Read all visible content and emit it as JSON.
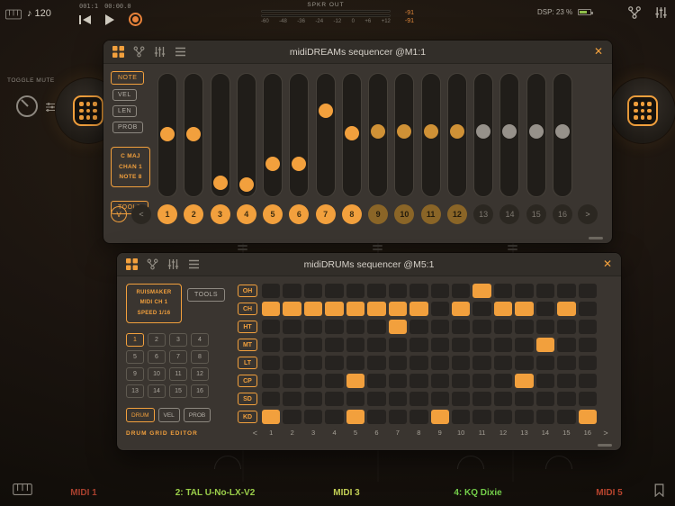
{
  "topbar": {
    "tempo_note": "♪",
    "tempo": "120",
    "time_bars": "001:1",
    "time_clock": "00:00.0",
    "spkr_label": "SPKR OUT",
    "meter_ticks": [
      "-60",
      "-48",
      "-36",
      "-24",
      "-12",
      "0",
      "+6",
      "+12"
    ],
    "db_left": "-91",
    "db_right": "-91",
    "dsp": "DSP: 23 %"
  },
  "left_cluster": {
    "toggle_mute_label": "TOGGLE MUTE"
  },
  "seq_window": {
    "title": "midiDREAMs sequencer @M1:1",
    "close_label": "✕",
    "left_buttons": {
      "note": "NOTE",
      "vel": "VEL",
      "len": "LEN",
      "prob": "PROB",
      "tools": "TOOLS"
    },
    "info_lines": [
      "C MAJ",
      "CHAN 1",
      "NOTE 8"
    ],
    "v_label": "V",
    "prev_label": "<",
    "next_label": ">",
    "steps": [
      {
        "n": "1",
        "state": "on"
      },
      {
        "n": "2",
        "state": "on"
      },
      {
        "n": "3",
        "state": "on"
      },
      {
        "n": "4",
        "state": "on"
      },
      {
        "n": "5",
        "state": "on"
      },
      {
        "n": "6",
        "state": "on"
      },
      {
        "n": "7",
        "state": "on"
      },
      {
        "n": "8",
        "state": "on"
      },
      {
        "n": "9",
        "state": "mid"
      },
      {
        "n": "10",
        "state": "mid"
      },
      {
        "n": "11",
        "state": "mid"
      },
      {
        "n": "12",
        "state": "mid"
      },
      {
        "n": "13",
        "state": "off"
      },
      {
        "n": "14",
        "state": "off"
      },
      {
        "n": "15",
        "state": "off"
      },
      {
        "n": "16",
        "state": "off"
      }
    ],
    "sliders": [
      {
        "value": 0.51,
        "state": "on"
      },
      {
        "value": 0.51,
        "state": "on"
      },
      {
        "value": 0.05,
        "state": "on"
      },
      {
        "value": 0.03,
        "state": "on"
      },
      {
        "value": 0.23,
        "state": "on"
      },
      {
        "value": 0.23,
        "state": "on"
      },
      {
        "value": 0.73,
        "state": "on"
      },
      {
        "value": 0.52,
        "state": "on"
      },
      {
        "value": 0.53,
        "state": "mid"
      },
      {
        "value": 0.53,
        "state": "mid"
      },
      {
        "value": 0.53,
        "state": "mid"
      },
      {
        "value": 0.53,
        "state": "mid"
      },
      {
        "value": 0.53,
        "state": "off"
      },
      {
        "value": 0.53,
        "state": "off"
      },
      {
        "value": 0.53,
        "state": "off"
      },
      {
        "value": 0.53,
        "state": "off"
      }
    ]
  },
  "drum_window": {
    "title": "midiDRUMs sequencer @M5:1",
    "close_label": "✕",
    "info_lines": [
      "RUISMAKER",
      "MIDI CH 1",
      "SPEED 1/16"
    ],
    "tools_label": "TOOLS",
    "pads": [
      "1",
      "2",
      "3",
      "4",
      "5",
      "6",
      "7",
      "8",
      "9",
      "10",
      "11",
      "12",
      "13",
      "14",
      "15",
      "16"
    ],
    "selected_pad": "1",
    "modes": [
      {
        "label": "DRUM",
        "active": true
      },
      {
        "label": "VEL",
        "active": false
      },
      {
        "label": "PROB",
        "active": false
      }
    ],
    "editor_label": "DRUM GRID EDITOR",
    "prev_label": "<",
    "next_label": ">",
    "col_numbers": [
      "1",
      "2",
      "3",
      "4",
      "5",
      "6",
      "7",
      "8",
      "9",
      "10",
      "11",
      "12",
      "13",
      "14",
      "15",
      "16"
    ],
    "rows": [
      {
        "label": "OH",
        "active": [
          11
        ]
      },
      {
        "label": "CH",
        "active": [
          1,
          2,
          3,
          4,
          5,
          6,
          7,
          8,
          10,
          12,
          13,
          15
        ]
      },
      {
        "label": "HT",
        "active": [
          7
        ]
      },
      {
        "label": "MT",
        "active": [
          14
        ]
      },
      {
        "label": "LT",
        "active": []
      },
      {
        "label": "CP",
        "active": [
          5,
          13
        ]
      },
      {
        "label": "SD",
        "active": []
      },
      {
        "label": "KD",
        "active": [
          1,
          5,
          9,
          16
        ]
      }
    ]
  },
  "mixer_bar": {
    "channels": [
      {
        "label": "MIDI 1",
        "color": "#a8402e"
      },
      {
        "label": "2: TAL U-No-LX-V2",
        "color": "#9bcf4a"
      },
      {
        "label": "MIDI 3",
        "color": "#c2cf55"
      },
      {
        "label": "4: KQ Dixie",
        "color": "#74cf4a"
      },
      {
        "label": "MIDI 5",
        "color": "#b8442e"
      }
    ]
  },
  "colors": {
    "accent": "#f2a03d",
    "dim_accent": "#8a6527",
    "inactive": "#96918a"
  }
}
